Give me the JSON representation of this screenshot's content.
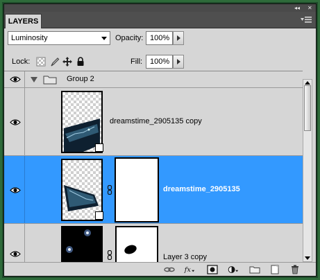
{
  "panel": {
    "tab_label": "LAYERS",
    "collapse_icon": "double-chevron-icon",
    "close_icon": "close-icon",
    "menu_icon": "panel-menu-icon"
  },
  "options": {
    "blend_mode": "Luminosity",
    "opacity_label": "Opacity:",
    "opacity_value": "100%",
    "lock_label": "Lock:",
    "fill_label": "Fill:",
    "fill_value": "100%"
  },
  "layers": [
    {
      "name": "Group 2",
      "type": "group",
      "visible": true,
      "expanded": true,
      "selected": false
    },
    {
      "name": "dreamstime_2905135 copy",
      "type": "smart-object",
      "visible": true,
      "selected": false
    },
    {
      "name": "dreamstime_2905135",
      "type": "smart-object-with-mask",
      "visible": true,
      "selected": true
    },
    {
      "name": "Layer 3 copy",
      "type": "layer-with-mask",
      "visible": true,
      "selected": false
    }
  ],
  "colors": {
    "selection": "#3399ff",
    "panel_bg": "#d6d6d6",
    "frame": "#2e6b3a"
  },
  "bottom_toolbar": [
    "link-layers-icon",
    "fx-icon",
    "add-mask-icon",
    "adjustment-layer-icon",
    "new-group-icon",
    "new-layer-icon",
    "trash-icon"
  ]
}
